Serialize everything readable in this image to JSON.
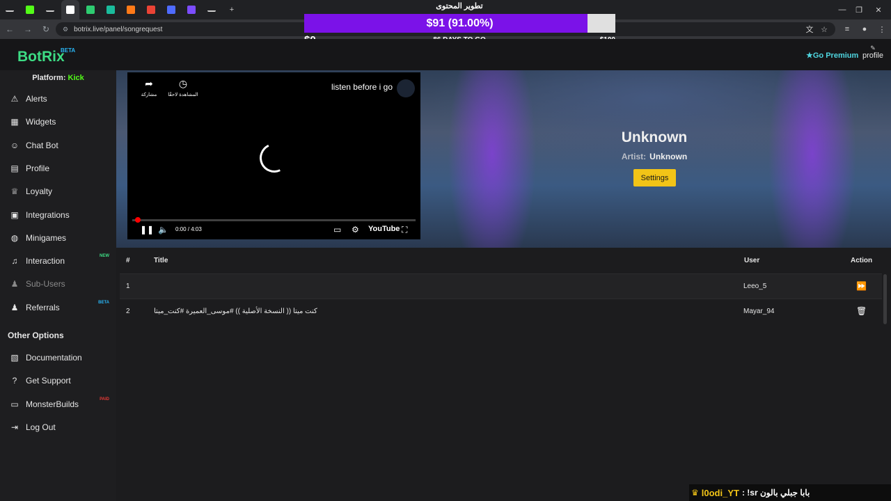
{
  "browser": {
    "tab_icons": [
      {
        "icon": "chevron-down-icon",
        "color": "#cfcfcf"
      },
      {
        "icon": "kick-icon",
        "color": "#53fc18"
      },
      {
        "icon": "speaker-icon",
        "color": "#cfcfcf"
      },
      {
        "icon": "botrix-icon",
        "color": "#ffffff"
      },
      {
        "icon": "green-app-icon",
        "color": "#2ecc71"
      },
      {
        "icon": "green-window-icon",
        "color": "#1abc9c"
      },
      {
        "icon": "orange-app-icon",
        "color": "#ff7a18"
      },
      {
        "icon": "gmail-icon",
        "color": "#ea4335"
      },
      {
        "icon": "shield-app-icon",
        "color": "#4f6bff"
      },
      {
        "icon": "purple-app-icon",
        "color": "#7c4dff"
      },
      {
        "icon": "tab-icon",
        "color": "#cfcfcf"
      }
    ],
    "new_tab": "+",
    "url": "botrix.live/panel/songrequest"
  },
  "donation_goal": {
    "title": "تطوير المحتوى",
    "amount_text": "$91 (91.00%)",
    "progress": 0.91,
    "min": "$0",
    "max": "$100",
    "days_left": "86 DAYS TO GO",
    "fill_color": "#7b12e8"
  },
  "header": {
    "logo": "BotRix",
    "logo_badge": "BETA",
    "go_premium": "Go Premium",
    "profile": "profile"
  },
  "sidebar": {
    "platform_label": "Platform:",
    "platform_value": "Kick",
    "items": [
      {
        "label": "Alerts",
        "icon": "warning-icon",
        "glyph": "⚠"
      },
      {
        "label": "Widgets",
        "icon": "widgets-icon",
        "glyph": "▦"
      },
      {
        "label": "Chat Bot",
        "icon": "robot-icon",
        "glyph": "☺"
      },
      {
        "label": "Profile",
        "icon": "id-card-icon",
        "glyph": "▤"
      },
      {
        "label": "Loyalty",
        "icon": "trophy-icon",
        "glyph": "♕"
      },
      {
        "label": "Integrations",
        "icon": "integrations-icon",
        "glyph": "▣"
      },
      {
        "label": "Minigames",
        "icon": "gamepad-icon",
        "glyph": "◍"
      },
      {
        "label": "Interaction",
        "icon": "music-icon",
        "glyph": "♫",
        "badge": "NEW"
      },
      {
        "label": "Sub-Users",
        "icon": "users-icon",
        "glyph": "♟",
        "dim": true
      },
      {
        "label": "Referrals",
        "icon": "referrals-icon",
        "glyph": "♟",
        "badge": "BETA"
      }
    ],
    "other_options_label": "Other Options",
    "other_items": [
      {
        "label": "Documentation",
        "icon": "scroll-icon",
        "glyph": "▧"
      },
      {
        "label": "Get Support",
        "icon": "question-icon",
        "glyph": "?"
      },
      {
        "label": "MonsterBuilds",
        "icon": "laptop-icon",
        "glyph": "▭",
        "badge": "PAID"
      },
      {
        "label": "Log Out",
        "icon": "logout-icon",
        "glyph": "⇥"
      }
    ],
    "badge_colors": {
      "NEW": "#3ddc84",
      "BETA": "#29b6f6",
      "PAID": "#e53935"
    }
  },
  "player": {
    "video_title": "listen before i go",
    "share_label": "مشاركة",
    "watch_later_label": "المشاهدة لاحقًا",
    "time": "0:00 / 4:03",
    "youtube_label": "YouTube",
    "progress": 0
  },
  "song": {
    "title": "Unknown",
    "artist_label": "Artist:",
    "artist": "Unknown",
    "settings_label": "Settings"
  },
  "queue": {
    "columns": [
      "#",
      "Title",
      "User",
      "Action"
    ],
    "rows": [
      {
        "index": "1",
        "title": "",
        "user": "Leeo_5",
        "action_icon": "skip-forward-icon",
        "action_glyph": "⏩"
      },
      {
        "index": "2",
        "title": "كنت ميتا (( النسخة الأصلية )) #موسى_العميرة #كنت_ميتا",
        "user": "Mayar_94",
        "action_icon": "trash-icon",
        "action_glyph": "🗑"
      }
    ]
  },
  "chat": {
    "user": "l0odi_YT",
    "message": ": !sr بابا جبلي بالون"
  }
}
